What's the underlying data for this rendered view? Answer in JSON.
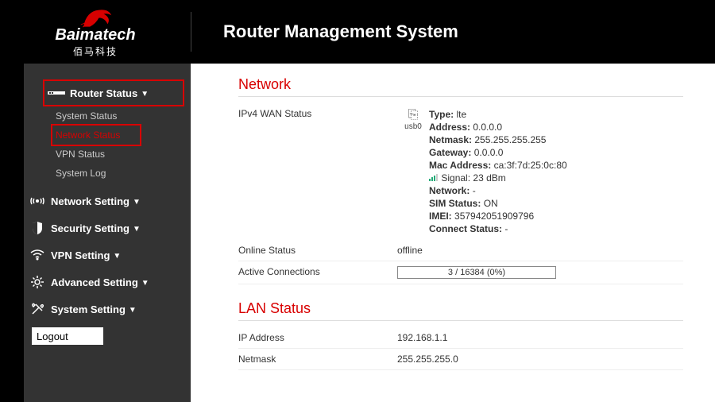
{
  "brand": {
    "name": "Baimatech",
    "sub": "佰马科技"
  },
  "header": {
    "title": "Router Management System"
  },
  "nav": {
    "router_status": {
      "label": "Router Status",
      "items": [
        "System Status",
        "Network Status",
        "VPN Status",
        "System Log"
      ]
    },
    "network_setting": "Network Setting",
    "security_setting": "Security Setting",
    "vpn_setting": "VPN Setting",
    "advanced_setting": "Advanced Setting",
    "system_setting": "System Setting",
    "logout": "Logout"
  },
  "network": {
    "title": "Network",
    "wan_label": "IPv4 WAN Status",
    "port": "usb0",
    "details": {
      "type_k": "Type:",
      "type_v": "lte",
      "address_k": "Address:",
      "address_v": "0.0.0.0",
      "netmask_k": "Netmask:",
      "netmask_v": "255.255.255.255",
      "gateway_k": "Gateway:",
      "gateway_v": "0.0.0.0",
      "mac_k": "Mac Address:",
      "mac_v": "ca:3f:7d:25:0c:80",
      "signal_k": "Signal:",
      "signal_v": "23 dBm",
      "network_k": "Network:",
      "network_v": "-",
      "sim_k": "SIM Status:",
      "sim_v": "ON",
      "imei_k": "IMEI:",
      "imei_v": "357942051909796",
      "connect_k": "Connect Status:",
      "connect_v": "-"
    },
    "online_label": "Online Status",
    "online_value": "offline",
    "conn_label": "Active Connections",
    "conn_value": "3 / 16384 (0%)"
  },
  "lan": {
    "title": "LAN Status",
    "ip_label": "IP Address",
    "ip_value": "192.168.1.1",
    "netmask_label": "Netmask",
    "netmask_value": "255.255.255.0"
  }
}
